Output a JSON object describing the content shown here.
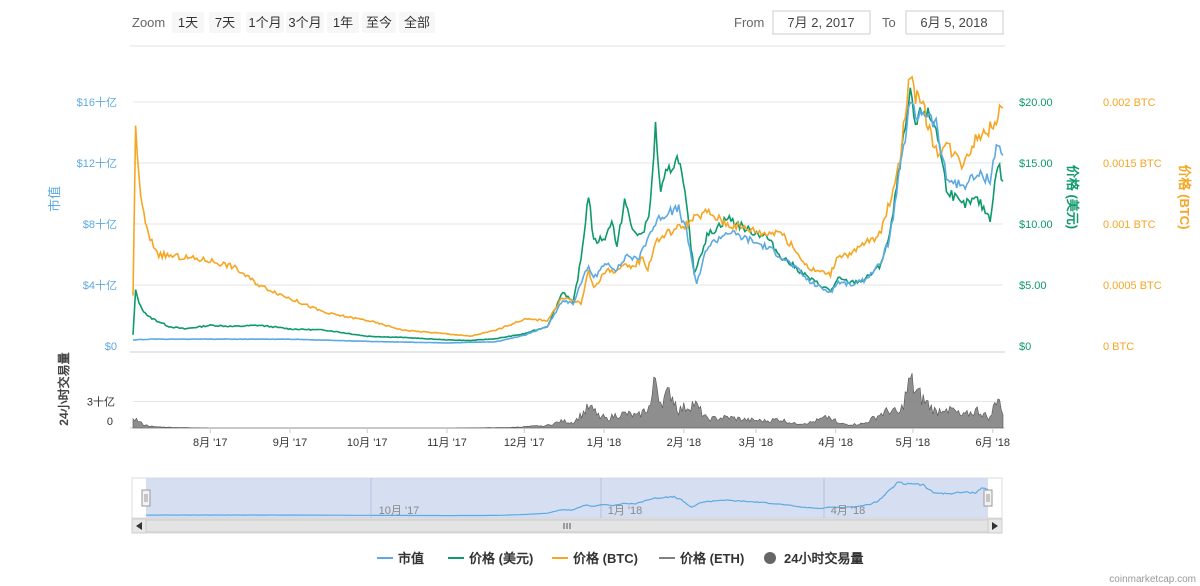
{
  "range_selector": {
    "zoom_label": "Zoom",
    "buttons": [
      "1天",
      "7天",
      "1个月",
      "3个月",
      "1年",
      "至今",
      "全部"
    ],
    "from_label": "From",
    "from_value": "7月 2, 2017",
    "to_label": "To",
    "to_value": "6月 5, 2018"
  },
  "credit": "coinmarketcap.com",
  "colors": {
    "market_cap": "#5da9e2",
    "price_usd": "#0e9a6d",
    "price_btc": "#f5a623",
    "price_eth": "#808080",
    "volume": "#7a7a7a"
  },
  "chart_data": {
    "type": "line",
    "axes": {
      "market_cap": {
        "title": "市值",
        "ticks": [
          "$0",
          "$4十亿",
          "$8十亿",
          "$12十亿",
          "$16十亿"
        ],
        "range": [
          0,
          16
        ]
      },
      "price_usd": {
        "title": "价格 (美元)",
        "ticks": [
          "$0",
          "$5.00",
          "$10.00",
          "$15.00",
          "$20.00"
        ],
        "range": [
          0,
          20
        ]
      },
      "price_btc": {
        "title": "价格 (BTC)",
        "ticks": [
          "0 BTC",
          "0.0005 BTC",
          "0.001 BTC",
          "0.0015 BTC",
          "0.002 BTC"
        ],
        "range": [
          0,
          0.002
        ]
      },
      "volume": {
        "title": "24小时交易量",
        "ticks": [
          "0",
          "3十亿"
        ],
        "range": [
          0,
          6
        ]
      },
      "x": {
        "ticks": [
          "8月 '17",
          "9月 '17",
          "10月 '17",
          "11月 '17",
          "12月 '17",
          "1月 '18",
          "2月 '18",
          "3月 '18",
          "4月 '18",
          "5月 '18",
          "6月 '18"
        ],
        "range": [
          "2017-07-02",
          "2018-06-05"
        ]
      }
    },
    "navigator_ticks": [
      "10月 '17",
      "1月 '18",
      "4月 '18"
    ],
    "legend": [
      "市值",
      "价格 (美元)",
      "价格 (BTC)",
      "价格 (ETH)",
      "24小时交易量"
    ],
    "series": [
      {
        "name": "价格 (美元)",
        "axis": "price_usd",
        "points": [
          [
            "2017-07-02",
            0.9
          ],
          [
            "2017-07-03",
            4.5
          ],
          [
            "2017-07-05",
            3.2
          ],
          [
            "2017-07-08",
            2.4
          ],
          [
            "2017-07-12",
            2.0
          ],
          [
            "2017-07-16",
            1.6
          ],
          [
            "2017-07-22",
            1.4
          ],
          [
            "2017-08-01",
            1.7
          ],
          [
            "2017-08-10",
            1.6
          ],
          [
            "2017-08-20",
            1.7
          ],
          [
            "2017-09-01",
            1.4
          ],
          [
            "2017-09-15",
            1.3
          ],
          [
            "2017-10-01",
            0.8
          ],
          [
            "2017-10-15",
            0.7
          ],
          [
            "2017-11-01",
            0.5
          ],
          [
            "2017-11-10",
            0.45
          ],
          [
            "2017-11-20",
            0.6
          ],
          [
            "2017-12-01",
            1.0
          ],
          [
            "2017-12-10",
            1.6
          ],
          [
            "2017-12-16",
            4.5
          ],
          [
            "2017-12-20",
            3.5
          ],
          [
            "2017-12-23",
            7.0
          ],
          [
            "2017-12-26",
            12.5
          ],
          [
            "2017-12-28",
            8.5
          ],
          [
            "2018-01-02",
            9.0
          ],
          [
            "2018-01-04",
            10.5
          ],
          [
            "2018-01-06",
            8.0
          ],
          [
            "2018-01-09",
            12.0
          ],
          [
            "2018-01-12",
            9.5
          ],
          [
            "2018-01-16",
            9.0
          ],
          [
            "2018-01-19",
            11.5
          ],
          [
            "2018-01-21",
            18.0
          ],
          [
            "2018-01-23",
            12.5
          ],
          [
            "2018-01-25",
            14.0
          ],
          [
            "2018-01-30",
            15.5
          ],
          [
            "2018-02-02",
            11.5
          ],
          [
            "2018-02-05",
            6.0
          ],
          [
            "2018-02-10",
            9.0
          ],
          [
            "2018-02-18",
            10.5
          ],
          [
            "2018-02-26",
            9.5
          ],
          [
            "2018-03-05",
            9.0
          ],
          [
            "2018-03-10",
            7.5
          ],
          [
            "2018-03-16",
            6.5
          ],
          [
            "2018-03-22",
            5.5
          ],
          [
            "2018-03-30",
            4.5
          ],
          [
            "2018-04-02",
            5.5
          ],
          [
            "2018-04-07",
            5.2
          ],
          [
            "2018-04-12",
            5.4
          ],
          [
            "2018-04-18",
            6.5
          ],
          [
            "2018-04-22",
            9.0
          ],
          [
            "2018-04-26",
            15.0
          ],
          [
            "2018-04-30",
            20.5
          ],
          [
            "2018-05-02",
            18.0
          ],
          [
            "2018-05-05",
            19.5
          ],
          [
            "2018-05-10",
            18.0
          ],
          [
            "2018-05-14",
            13.0
          ],
          [
            "2018-05-20",
            11.5
          ],
          [
            "2018-05-26",
            12.0
          ],
          [
            "2018-05-31",
            10.5
          ],
          [
            "2018-06-03",
            15.0
          ],
          [
            "2018-06-05",
            13.5
          ]
        ]
      },
      {
        "name": "价格 (BTC)",
        "axis": "price_btc",
        "points": [
          [
            "2017-07-02",
            0.0004
          ],
          [
            "2017-07-03",
            0.0018
          ],
          [
            "2017-07-05",
            0.0012
          ],
          [
            "2017-07-08",
            0.0009
          ],
          [
            "2017-07-12",
            0.00075
          ],
          [
            "2017-07-20",
            0.00073
          ],
          [
            "2017-08-01",
            0.0007
          ],
          [
            "2017-08-10",
            0.00065
          ],
          [
            "2017-08-20",
            0.0005
          ],
          [
            "2017-09-01",
            0.00039
          ],
          [
            "2017-09-15",
            0.00027
          ],
          [
            "2017-10-01",
            0.00021
          ],
          [
            "2017-10-15",
            0.00013
          ],
          [
            "2017-11-01",
            0.0001
          ],
          [
            "2017-11-10",
            8e-05
          ],
          [
            "2017-11-20",
            0.00013
          ],
          [
            "2017-12-01",
            0.00022
          ],
          [
            "2017-12-10",
            0.00021
          ],
          [
            "2017-12-16",
            0.0004
          ],
          [
            "2017-12-23",
            0.00035
          ],
          [
            "2017-12-26",
            0.00061
          ],
          [
            "2017-12-28",
            0.00048
          ],
          [
            "2018-01-02",
            0.00062
          ],
          [
            "2018-01-06",
            0.00062
          ],
          [
            "2018-01-09",
            0.00065
          ],
          [
            "2018-01-12",
            0.00065
          ],
          [
            "2018-01-16",
            0.00072
          ],
          [
            "2018-01-18",
            0.00063
          ],
          [
            "2018-01-21",
            0.00085
          ],
          [
            "2018-01-25",
            0.00092
          ],
          [
            "2018-02-02",
            0.001
          ],
          [
            "2018-02-05",
            0.00104
          ],
          [
            "2018-02-10",
            0.0011
          ],
          [
            "2018-02-18",
            0.001
          ],
          [
            "2018-02-26",
            0.00096
          ],
          [
            "2018-03-05",
            0.00092
          ],
          [
            "2018-03-10",
            0.00095
          ],
          [
            "2018-03-16",
            0.00079
          ],
          [
            "2018-03-22",
            0.00063
          ],
          [
            "2018-03-30",
            0.00059
          ],
          [
            "2018-04-02",
            0.00075
          ],
          [
            "2018-04-07",
            0.00075
          ],
          [
            "2018-04-12",
            0.00084
          ],
          [
            "2018-04-18",
            0.00091
          ],
          [
            "2018-04-22",
            0.00118
          ],
          [
            "2018-04-26",
            0.00155
          ],
          [
            "2018-04-30",
            0.00226
          ],
          [
            "2018-05-02",
            0.00205
          ],
          [
            "2018-05-05",
            0.00195
          ],
          [
            "2018-05-10",
            0.0016
          ],
          [
            "2018-05-14",
            0.00165
          ],
          [
            "2018-05-20",
            0.0015
          ],
          [
            "2018-05-26",
            0.00172
          ],
          [
            "2018-05-31",
            0.00178
          ],
          [
            "2018-06-03",
            0.0019
          ],
          [
            "2018-06-05",
            0.00195
          ]
        ]
      },
      {
        "name": "市值",
        "axis": "market_cap",
        "points": [
          [
            "2017-07-02",
            0.4
          ],
          [
            "2017-07-10",
            0.45
          ],
          [
            "2017-08-01",
            0.45
          ],
          [
            "2017-09-01",
            0.45
          ],
          [
            "2017-10-01",
            0.3
          ],
          [
            "2017-11-01",
            0.2
          ],
          [
            "2017-11-20",
            0.28
          ],
          [
            "2017-12-01",
            0.7
          ],
          [
            "2017-12-10",
            1.3
          ],
          [
            "2017-12-16",
            3.0
          ],
          [
            "2017-12-20",
            2.8
          ],
          [
            "2017-12-26",
            5.3
          ],
          [
            "2017-12-28",
            4.4
          ],
          [
            "2018-01-02",
            5.5
          ],
          [
            "2018-01-06",
            5.0
          ],
          [
            "2018-01-10",
            6.0
          ],
          [
            "2018-01-14",
            5.6
          ],
          [
            "2018-01-19",
            7.5
          ],
          [
            "2018-01-23",
            8.5
          ],
          [
            "2018-01-30",
            9.0
          ],
          [
            "2018-02-02",
            7.5
          ],
          [
            "2018-02-06",
            4.0
          ],
          [
            "2018-02-10",
            6.5
          ],
          [
            "2018-02-18",
            7.5
          ],
          [
            "2018-02-26",
            7.0
          ],
          [
            "2018-03-05",
            6.5
          ],
          [
            "2018-03-10",
            6.0
          ],
          [
            "2018-03-16",
            5.2
          ],
          [
            "2018-03-22",
            4.2
          ],
          [
            "2018-03-30",
            3.5
          ],
          [
            "2018-04-02",
            4.2
          ],
          [
            "2018-04-07",
            4.0
          ],
          [
            "2018-04-12",
            4.3
          ],
          [
            "2018-04-18",
            5.3
          ],
          [
            "2018-04-22",
            7.0
          ],
          [
            "2018-04-26",
            11.5
          ],
          [
            "2018-04-30",
            16.0
          ],
          [
            "2018-05-02",
            15.0
          ],
          [
            "2018-05-05",
            15.5
          ],
          [
            "2018-05-10",
            14.5
          ],
          [
            "2018-05-14",
            11.0
          ],
          [
            "2018-05-20",
            10.5
          ],
          [
            "2018-05-26",
            11.2
          ],
          [
            "2018-05-31",
            11.0
          ],
          [
            "2018-06-03",
            13.5
          ],
          [
            "2018-06-05",
            12.5
          ]
        ]
      },
      {
        "name": "24小时交易量",
        "axis": "volume",
        "points": [
          [
            "2017-07-02",
            1.2
          ],
          [
            "2017-07-06",
            0.4
          ],
          [
            "2017-07-10",
            0.15
          ],
          [
            "2017-07-20",
            0.05
          ],
          [
            "2017-08-01",
            0
          ],
          [
            "2017-09-01",
            0
          ],
          [
            "2017-10-01",
            0
          ],
          [
            "2017-11-01",
            0
          ],
          [
            "2017-11-25",
            0.05
          ],
          [
            "2017-12-10",
            0.3
          ],
          [
            "2017-12-16",
            0.8
          ],
          [
            "2017-12-20",
            0.6
          ],
          [
            "2017-12-26",
            2.3
          ],
          [
            "2018-01-02",
            1.0
          ],
          [
            "2018-01-06",
            1.5
          ],
          [
            "2018-01-10",
            1.6
          ],
          [
            "2018-01-14",
            1.3
          ],
          [
            "2018-01-19",
            2.5
          ],
          [
            "2018-01-21",
            5.7
          ],
          [
            "2018-01-23",
            3.0
          ],
          [
            "2018-01-27",
            4.0
          ],
          [
            "2018-01-30",
            2.0
          ],
          [
            "2018-02-05",
            2.8
          ],
          [
            "2018-02-10",
            1.0
          ],
          [
            "2018-02-18",
            1.2
          ],
          [
            "2018-02-26",
            0.9
          ],
          [
            "2018-03-05",
            0.8
          ],
          [
            "2018-03-10",
            1.0
          ],
          [
            "2018-03-16",
            0.5
          ],
          [
            "2018-03-22",
            0.6
          ],
          [
            "2018-03-30",
            1.3
          ],
          [
            "2018-04-02",
            0.5
          ],
          [
            "2018-04-07",
            0.4
          ],
          [
            "2018-04-12",
            0.5
          ],
          [
            "2018-04-18",
            1.5
          ],
          [
            "2018-04-22",
            2.0
          ],
          [
            "2018-04-26",
            1.6
          ],
          [
            "2018-04-30",
            5.4
          ],
          [
            "2018-05-02",
            4.2
          ],
          [
            "2018-05-05",
            3.2
          ],
          [
            "2018-05-10",
            1.8
          ],
          [
            "2018-05-14",
            2.5
          ],
          [
            "2018-05-20",
            1.3
          ],
          [
            "2018-05-26",
            2.0
          ],
          [
            "2018-05-31",
            1.1
          ],
          [
            "2018-06-03",
            3.8
          ],
          [
            "2018-06-05",
            1.5
          ]
        ]
      }
    ]
  }
}
